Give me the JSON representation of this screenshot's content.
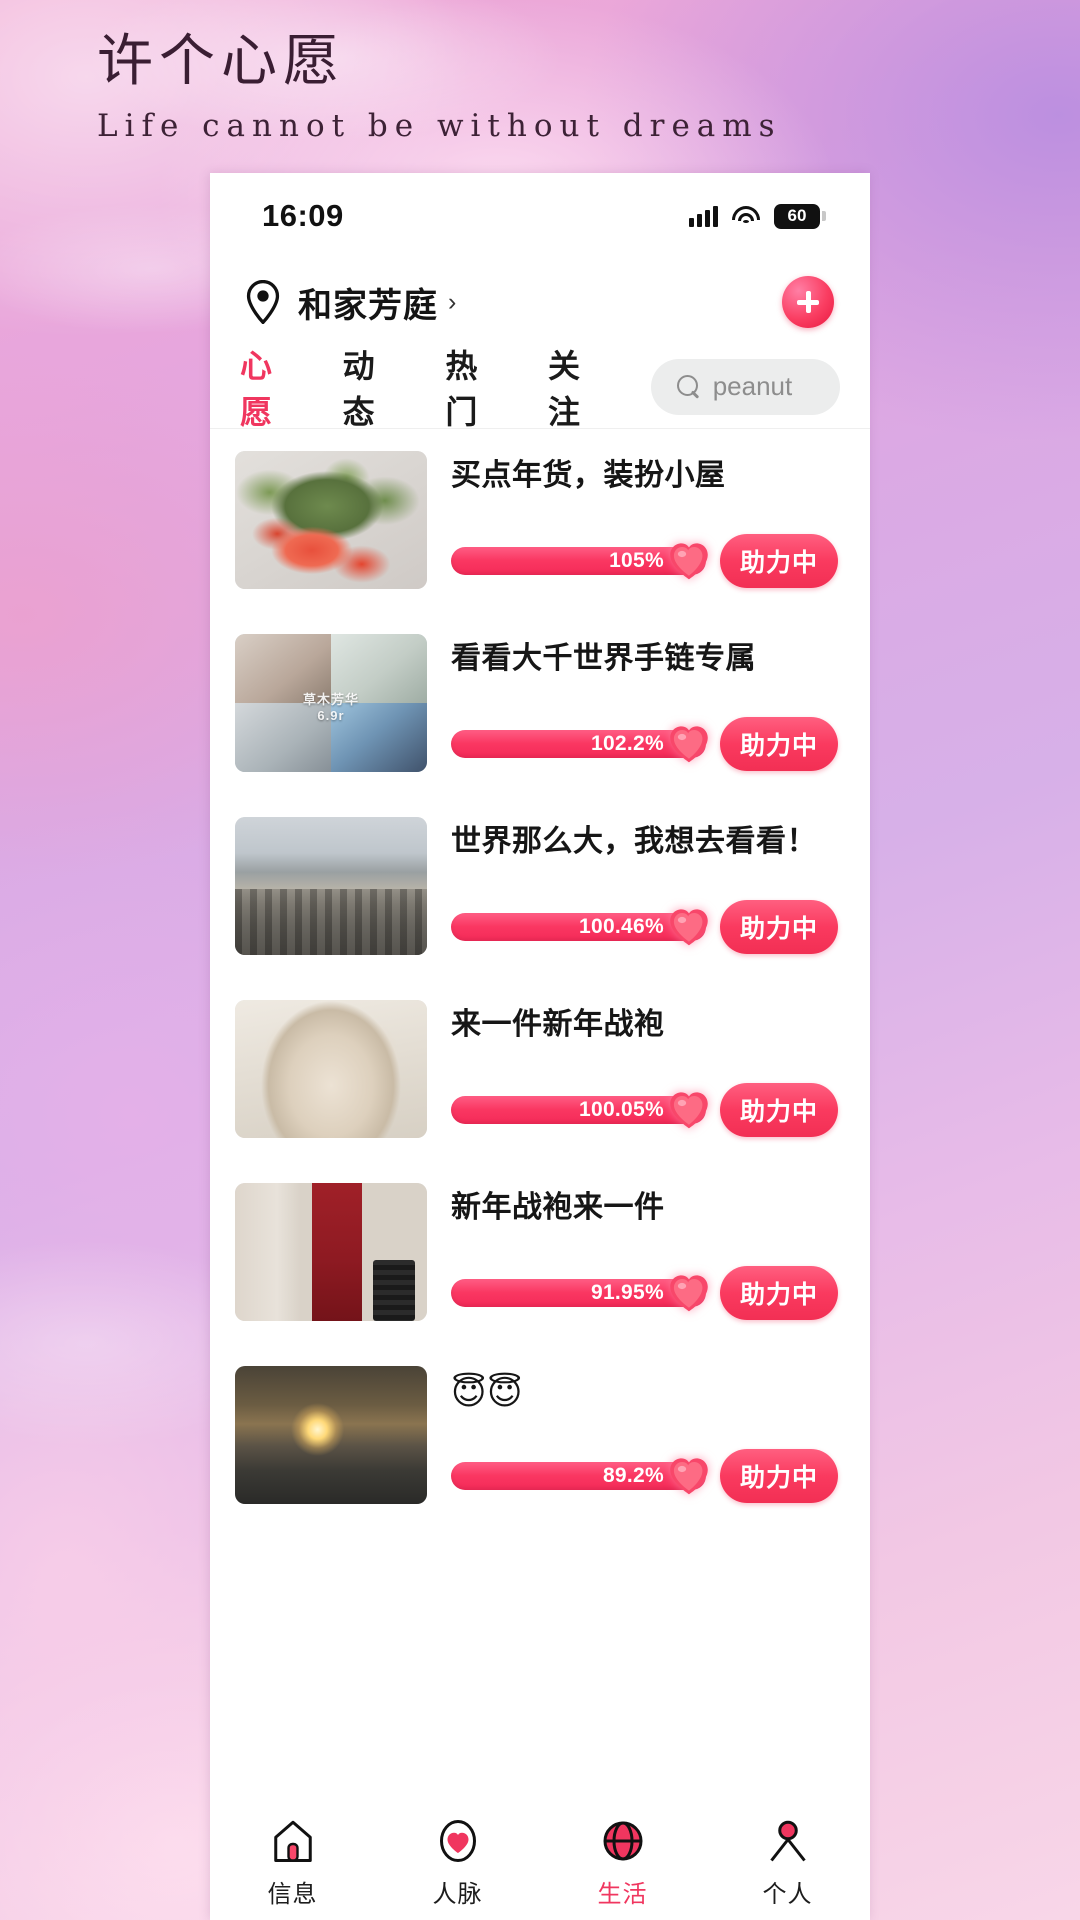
{
  "wallpaper": {
    "title": "许个心愿",
    "subtitle": "Life cannot be without dreams"
  },
  "status_bar": {
    "time": "16:09",
    "signal_icon": "signal-bars-icon",
    "wifi_icon": "wifi-icon",
    "battery_level": "60",
    "battery_icon": "battery-icon"
  },
  "location": {
    "pin_icon": "location-pin-icon",
    "name": "和家芳庭",
    "chevron": "›",
    "add_icon": "plus-icon"
  },
  "tabs": [
    {
      "label": "心愿",
      "active": true
    },
    {
      "label": "动态",
      "active": false
    },
    {
      "label": "热门",
      "active": false
    },
    {
      "label": "关注",
      "active": false
    }
  ],
  "search": {
    "icon": "search-icon",
    "placeholder": "peanut",
    "value": ""
  },
  "colors": {
    "accent": "#f0365f",
    "progress_fill": "#fa3762",
    "search_bg": "#eceded"
  },
  "wishes": [
    {
      "title": "买点年货，装扮小屋",
      "progress_label": "105%",
      "progress_value": 105,
      "button_label": "助力中",
      "thumb": "potted-plant-photo"
    },
    {
      "title": "看看大千世界手链专属",
      "progress_label": "102.2%",
      "progress_value": 102.2,
      "button_label": "助力中",
      "thumb": "bracelet-collage-photo",
      "thumb_watermark": "草木芳华\n6.9r"
    },
    {
      "title": "世界那么大，我想去看看！",
      "progress_label": "100.46%",
      "progress_value": 100.46,
      "button_label": "助力中",
      "thumb": "cityscape-photo"
    },
    {
      "title": "来一件新年战袍",
      "progress_label": "100.05%",
      "progress_value": 100.05,
      "button_label": "助力中",
      "thumb": "fur-coat-photo"
    },
    {
      "title": "新年战袍来一件",
      "progress_label": "91.95%",
      "progress_value": 91.95,
      "button_label": "助力中",
      "thumb": "red-dress-photo"
    },
    {
      "title": "😇😇",
      "progress_label": "89.2%",
      "progress_value": 89.2,
      "button_label": "助力中",
      "thumb": "sunrise-photo",
      "emoji_title": true
    }
  ],
  "bottom_nav": [
    {
      "label": "信息",
      "icon": "house-icon",
      "active": false
    },
    {
      "label": "人脉",
      "icon": "heart-icon",
      "active": false
    },
    {
      "label": "生活",
      "icon": "globe-icon",
      "active": true
    },
    {
      "label": "个人",
      "icon": "person-icon",
      "active": false
    }
  ]
}
